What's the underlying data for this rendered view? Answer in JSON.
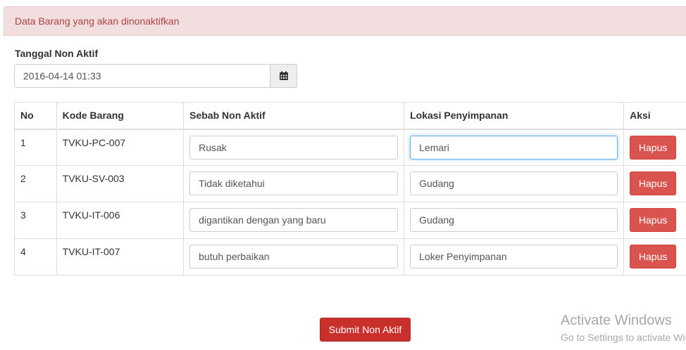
{
  "panel": {
    "heading": "Data Barang yang akan dinonaktifkan"
  },
  "form": {
    "date_label": "Tanggal Non Aktif",
    "date_value": "2016-04-14 01:33",
    "date_icon": "calendar-icon"
  },
  "table": {
    "headers": [
      "No",
      "Kode Barang",
      "Sebab Non Aktif",
      "Lokasi Penyimpanan",
      "Aksi"
    ],
    "rows": [
      {
        "no": "1",
        "kode": "TVKU-PC-007",
        "sebab": "Rusak",
        "lokasi": "Lemari",
        "aksi": "Hapus"
      },
      {
        "no": "2",
        "kode": "TVKU-SV-003",
        "sebab": "Tidak diketahui",
        "lokasi": "Gudang",
        "aksi": "Hapus"
      },
      {
        "no": "3",
        "kode": "TVKU-IT-006",
        "sebab": "digantikan dengan yang baru",
        "lokasi": "Gudang",
        "aksi": "Hapus"
      },
      {
        "no": "4",
        "kode": "TVKU-IT-007",
        "sebab": "butuh perbaikan",
        "lokasi": "Loker Penyimpanan",
        "aksi": "Hapus"
      }
    ]
  },
  "submit_label": "Submit Non Aktif",
  "watermark": {
    "title": "Activate Windows",
    "subtitle": "Go to Settings to activate Windows."
  },
  "colors": {
    "danger": "#d9534f",
    "danger_dark": "#c9302c",
    "alert_bg": "#f2dede",
    "alert_text": "#a94442"
  }
}
